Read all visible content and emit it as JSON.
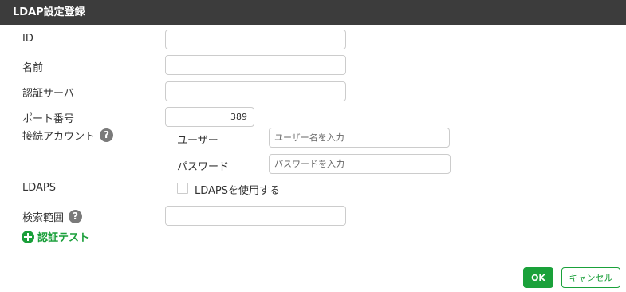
{
  "dialog": {
    "title": "LDAP設定登録"
  },
  "fields": {
    "id": {
      "label": "ID",
      "value": ""
    },
    "name": {
      "label": "名前",
      "value": ""
    },
    "auth_server": {
      "label": "認証サーバ",
      "value": ""
    },
    "port": {
      "label": "ポート番号",
      "value": "389"
    },
    "account": {
      "label": "接続アカウント",
      "user_label": "ユーザー",
      "user_placeholder": "ユーザー名を入力",
      "password_label": "パスワード",
      "password_placeholder": "パスワードを入力"
    },
    "ldaps": {
      "label": "LDAPS",
      "checkbox_label": "LDAPSを使用する",
      "checked": false
    },
    "search_scope": {
      "label": "検索範囲",
      "value": ""
    }
  },
  "help_icon_text": "?",
  "auth_test_link": "認証テスト",
  "buttons": {
    "ok": "OK",
    "cancel": "キャンセル"
  },
  "colors": {
    "accent": "#1aa13a",
    "titlebar": "#3c3c3c",
    "help_icon": "#7a7a7a"
  }
}
